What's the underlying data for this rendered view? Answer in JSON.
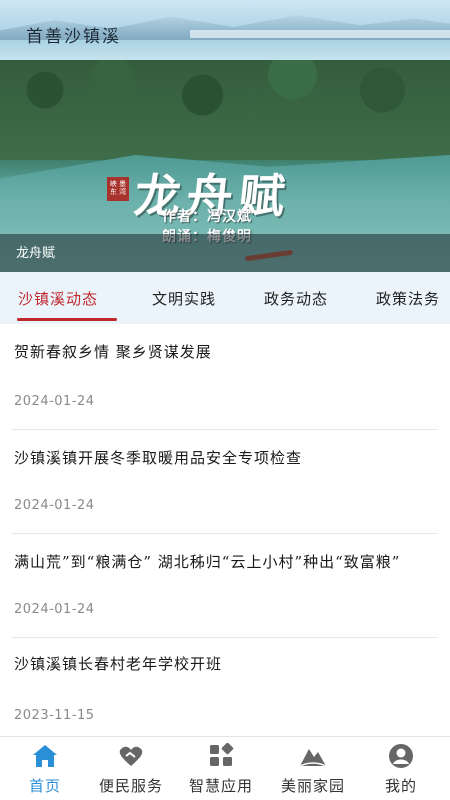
{
  "app": {
    "title": "首善沙镇溪"
  },
  "banner": {
    "title": "龙舟赋",
    "seal_text": "峡 墨 东 湾",
    "author_line": "作者：冯汉斌",
    "reader_line": "朗诵：梅俊明",
    "caption": "龙舟赋"
  },
  "tabs": [
    {
      "label": "沙镇溪动态",
      "active": true
    },
    {
      "label": "文明实践",
      "active": false
    },
    {
      "label": "政务动态",
      "active": false
    },
    {
      "label": "政策法务",
      "active": false
    }
  ],
  "news": [
    {
      "title": "贺新春叙乡情 聚乡贤谋发展",
      "date": "2024-01-24"
    },
    {
      "title": "沙镇溪镇开展冬季取暖用品安全专项检查",
      "date": "2024-01-24"
    },
    {
      "title": "满山荒”到“粮满仓” 湖北秭归“云上小村”种出“致富粮”",
      "date": "2024-01-24"
    },
    {
      "title": "沙镇溪镇长春村老年学校开班",
      "date": "2023-11-15"
    }
  ],
  "bottom_nav": [
    {
      "label": "首页",
      "icon": "home-icon",
      "active": true
    },
    {
      "label": "便民服务",
      "icon": "handshake-icon",
      "active": false
    },
    {
      "label": "智慧应用",
      "icon": "apps-grid-icon",
      "active": false
    },
    {
      "label": "美丽家园",
      "icon": "mountain-icon",
      "active": false
    },
    {
      "label": "我的",
      "icon": "user-icon",
      "active": false
    }
  ],
  "colors": {
    "accent_red": "#c0282e",
    "nav_active_blue": "#2a8fd6",
    "tab_bg": "#eaf4fa"
  }
}
